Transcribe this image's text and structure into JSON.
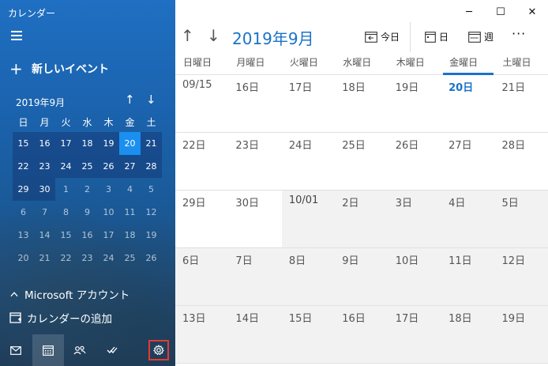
{
  "app": {
    "title": "カレンダー"
  },
  "sidebar": {
    "new_event_label": "新しいイベント",
    "mini_calendar": {
      "month_label": "2019年9月",
      "weekdays": [
        "日",
        "月",
        "火",
        "水",
        "木",
        "金",
        "土"
      ],
      "weeks": [
        [
          "15",
          "16",
          "17",
          "18",
          "19",
          "20",
          "21"
        ],
        [
          "22",
          "23",
          "24",
          "25",
          "26",
          "27",
          "28"
        ],
        [
          "29",
          "30",
          "1",
          "2",
          "3",
          "4",
          "5"
        ],
        [
          "6",
          "7",
          "8",
          "9",
          "10",
          "11",
          "12"
        ],
        [
          "13",
          "14",
          "15",
          "16",
          "17",
          "18",
          "19"
        ],
        [
          "20",
          "21",
          "22",
          "23",
          "24",
          "25",
          "26"
        ]
      ],
      "selected": "20"
    },
    "account_label": "Microsoft アカウント",
    "add_calendar_label": "カレンダーの追加",
    "bottom_icons": [
      "mail-icon",
      "calendar-icon",
      "people-icon",
      "todo-icon",
      "settings-icon"
    ]
  },
  "header": {
    "month_title": "2019年9月",
    "today_label": "今日",
    "day_label": "日",
    "week_label": "週",
    "more_label": "···"
  },
  "grid": {
    "weekdays": [
      "日曜日",
      "月曜日",
      "火曜日",
      "水曜日",
      "木曜日",
      "金曜日",
      "土曜日"
    ],
    "weeks": [
      [
        "09/15",
        "16日",
        "17日",
        "18日",
        "19日",
        "20日",
        "21日"
      ],
      [
        "22日",
        "23日",
        "24日",
        "25日",
        "26日",
        "27日",
        "28日"
      ],
      [
        "29日",
        "30日",
        "10/01",
        "2日",
        "3日",
        "4日",
        "5日"
      ],
      [
        "6日",
        "7日",
        "8日",
        "9日",
        "10日",
        "11日",
        "12日"
      ],
      [
        "13日",
        "14日",
        "15日",
        "16日",
        "17日",
        "18日",
        "19日"
      ]
    ]
  },
  "colors": {
    "accent": "#1a73c9",
    "selected_day": "#1a8ff0",
    "sidebar": "#1b63ae",
    "highlight_box": "#e53935"
  }
}
